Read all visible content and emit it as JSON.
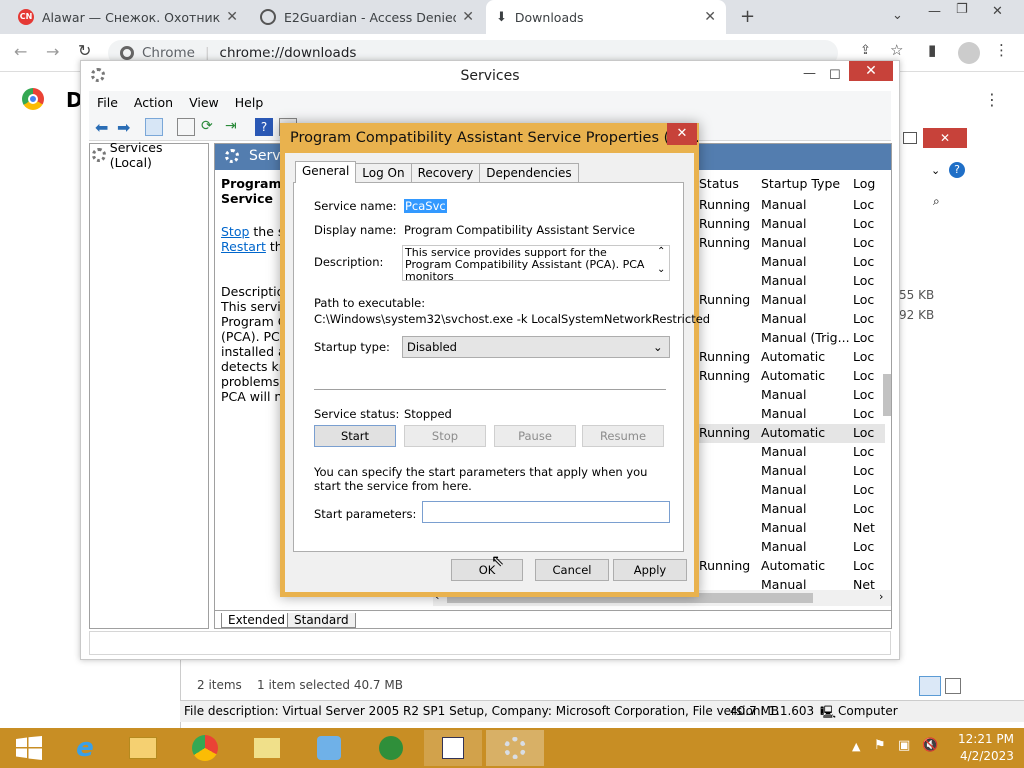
{
  "chrome": {
    "tabs": [
      {
        "title": "Alawar — Снежок. Охотник за с",
        "icon": "alawar-icon",
        "color": "#e53935"
      },
      {
        "title": "E2Guardian - Access Denied",
        "icon": "globe-icon"
      },
      {
        "title": "Downloads",
        "icon": "download-icon"
      }
    ],
    "address_origin": "Chrome",
    "address_url": "chrome://downloads"
  },
  "services": {
    "title": "Services",
    "menu": [
      "File",
      "Action",
      "View",
      "Help"
    ],
    "tree_item": "Services (Local)",
    "header_partial": "Servi",
    "svc_name_partial": [
      "Program C",
      "Service"
    ],
    "link_stop": "Stop",
    "link_stop_rest": " the se",
    "link_restart": "Restart",
    "link_restart_rest": " the",
    "desc_partial": [
      "Description",
      "This service",
      "Program Co",
      "(PCA).  PCA",
      "installed an",
      "detects kno",
      "problems. I",
      "PCA will no"
    ],
    "columns": [
      "Status",
      "Startup Type",
      "Log"
    ],
    "rows": [
      [
        "Running",
        "Manual",
        "Loc"
      ],
      [
        "Running",
        "Manual",
        "Loc"
      ],
      [
        "Running",
        "Manual",
        "Loc"
      ],
      [
        "",
        "Manual",
        "Loc"
      ],
      [
        "",
        "Manual",
        "Loc"
      ],
      [
        "Running",
        "Manual",
        "Loc"
      ],
      [
        "",
        "Manual",
        "Loc"
      ],
      [
        "",
        "Manual (Trig...",
        "Loc"
      ],
      [
        "Running",
        "Automatic",
        "Loc"
      ],
      [
        "Running",
        "Automatic",
        "Loc"
      ],
      [
        "",
        "Manual",
        "Loc"
      ],
      [
        "",
        "Manual",
        "Loc"
      ],
      [
        "Running",
        "Automatic",
        "Loc"
      ],
      [
        "",
        "Manual",
        "Loc"
      ],
      [
        "",
        "Manual",
        "Loc"
      ],
      [
        "",
        "Manual",
        "Loc"
      ],
      [
        "",
        "Manual",
        "Loc"
      ],
      [
        "",
        "Manual",
        "Net"
      ],
      [
        "",
        "Manual",
        "Loc"
      ],
      [
        "Running",
        "Automatic",
        "Loc"
      ],
      [
        "",
        "Manual",
        "Net"
      ]
    ],
    "tabs": [
      "Extended",
      "Standard"
    ]
  },
  "dialog": {
    "title": "Program Compatibility Assistant Service Properties (Lo...",
    "tabs": [
      "General",
      "Log On",
      "Recovery",
      "Dependencies"
    ],
    "service_name_label": "Service name:",
    "service_name": "PcaSvc",
    "display_name_label": "Display name:",
    "display_name": "Program Compatibility Assistant Service",
    "description_label": "Description:",
    "description": "This service provides support for the Program Compatibility Assistant (PCA).  PCA monitors",
    "path_label": "Path to executable:",
    "path": "C:\\Windows\\system32\\svchost.exe -k LocalSystemNetworkRestricted",
    "startup_label": "Startup type:",
    "startup_value": "Disabled",
    "status_label": "Service status:",
    "status_value": "Stopped",
    "btn_start": "Start",
    "btn_stop": "Stop",
    "btn_pause": "Pause",
    "btn_resume": "Resume",
    "hint": "You can specify the start parameters that apply when you start the service from here.",
    "params_label": "Start parameters:",
    "params_value": "",
    "btn_ok": "OK",
    "btn_cancel": "Cancel",
    "btn_apply": "Apply"
  },
  "downloads": {
    "size1": "55 KB",
    "size2": "92 KB",
    "items": "2 items",
    "selected": "1 item selected  40.7 MB",
    "file_desc": "File description: Virtual Server 2005 R2 SP1 Setup, Company: Microsoft Corporation, File version: 1.1.603",
    "size": "40.7 MB",
    "location": "Computer"
  },
  "taskbar": {
    "time": "12:21 PM",
    "date": "4/2/2023"
  },
  "colors": {
    "accent": "#e9b24e",
    "taskbar": "#c88e24",
    "close": "#c7423a",
    "link": "#0066cc"
  }
}
